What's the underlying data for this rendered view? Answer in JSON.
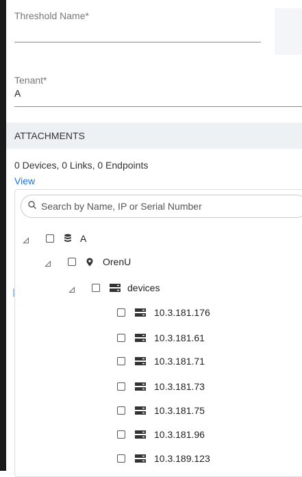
{
  "form": {
    "threshold_name_label": "Threshold Name*",
    "threshold_name_value": "",
    "tenant_label": "Tenant*",
    "tenant_value": "A"
  },
  "attachments": {
    "header": "ATTACHMENTS",
    "summary": "0 Devices, 0 Links, 0 Endpoints",
    "view_link": "View",
    "search_placeholder": "Search by Name, IP or Serial Number"
  },
  "tree": {
    "tenant": {
      "label": "A",
      "icon": "database-icon"
    },
    "site": {
      "label": "OrenU",
      "icon": "location-pin-icon"
    },
    "group": {
      "label": "devices",
      "icon": "server-icon"
    },
    "devices": [
      {
        "label": "10.3.181.176",
        "icon": "server-icon"
      },
      {
        "label": "10.3.181.61",
        "icon": "server-icon"
      },
      {
        "label": "10.3.181.71",
        "icon": "server-icon"
      },
      {
        "label": "10.3.181.73",
        "icon": "server-icon"
      },
      {
        "label": "10.3.181.75",
        "icon": "server-icon"
      },
      {
        "label": "10.3.181.96",
        "icon": "server-icon"
      },
      {
        "label": "10.3.189.123",
        "icon": "server-icon"
      }
    ]
  },
  "colors": {
    "link": "#1a73e8",
    "header_bg": "#eef1f4",
    "border": "#dcdcdc"
  }
}
